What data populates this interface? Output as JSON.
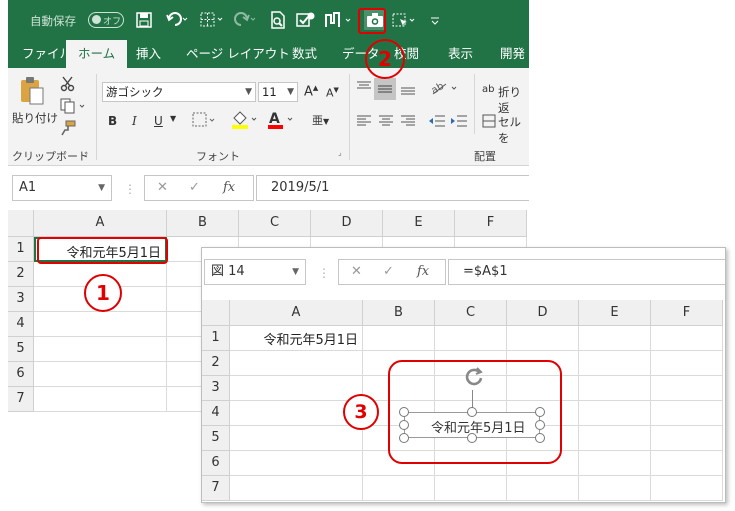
{
  "qat": {
    "autosave_label": "自動保存",
    "autosave_state": "オフ",
    "icons": [
      "save-icon",
      "undo-icon",
      "border-icon",
      "redo-icon",
      "print-preview-icon",
      "check-icon",
      "shape-icon",
      "camera-icon",
      "select-objects-icon",
      "customize-icon"
    ]
  },
  "tabs": [
    "ファイル",
    "ホーム",
    "挿入",
    "ページ レイアウト",
    "数式",
    "データ",
    "校閲",
    "表示",
    "開発"
  ],
  "ribbon": {
    "paste_label": "貼り付け",
    "clipboard_group": "クリップボード",
    "font_name": "游ゴシック",
    "font_size": "11",
    "bold": "B",
    "italic": "I",
    "underline": "U",
    "font_group": "フォント",
    "wrap_label": "折り返",
    "merge_label": "セルを",
    "align_group": "配置"
  },
  "win1": {
    "namebox": "A1",
    "formula": "2019/5/1",
    "columns": [
      "A",
      "B",
      "C",
      "D",
      "E",
      "F"
    ],
    "rows": [
      "1",
      "2",
      "3",
      "4",
      "5",
      "6",
      "7"
    ],
    "a1_value": "令和元年5月1日"
  },
  "win2": {
    "namebox": "図 14",
    "formula": "=$A$1",
    "columns": [
      "A",
      "B",
      "C",
      "D",
      "E",
      "F"
    ],
    "rows": [
      "1",
      "2",
      "3",
      "4",
      "5",
      "6",
      "7"
    ],
    "a1_value": "令和元年5月1日",
    "picture_text": "令和元年5月1日"
  },
  "callouts": [
    "1",
    "2",
    "3"
  ],
  "colors": {
    "excel_green": "#217346",
    "callout_red": "#e00000"
  }
}
